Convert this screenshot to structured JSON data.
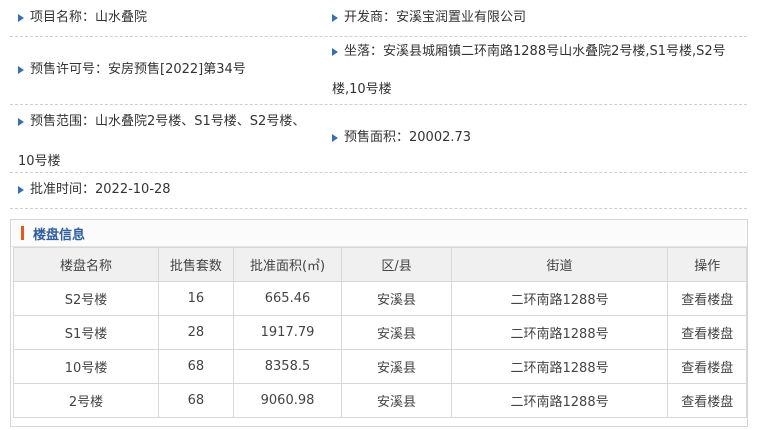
{
  "project": {
    "name_label": "项目名称：山水叠院",
    "developer_label": "开发商：安溪宝润置业有限公司",
    "permit_label": "预售许可号：安房预售[2022]第34号",
    "location_line1": "坐落：安溪县城厢镇二环南路1288号山水叠院2号楼,S1号楼,S2号",
    "location_line2": "楼,10号楼",
    "scope_line1": "预售范围：山水叠院2号楼、S1号楼、S2号楼、",
    "scope_line2": "10号楼",
    "area_label": "预售面积：20002.73",
    "approval_label": "批准时间：2022-10-28"
  },
  "section": {
    "title": "楼盘信息"
  },
  "table": {
    "headers": [
      "楼盘名称",
      "批售套数",
      "批准面积(㎡)",
      "区/县",
      "街道",
      "操作"
    ],
    "rows": [
      [
        "S2号楼",
        "16",
        "665.46",
        "安溪县",
        "二环南路1288号",
        "查看楼盘"
      ],
      [
        "S1号楼",
        "28",
        "1917.79",
        "安溪县",
        "二环南路1288号",
        "查看楼盘"
      ],
      [
        "10号楼",
        "68",
        "8358.5",
        "安溪县",
        "二环南路1288号",
        "查看楼盘"
      ],
      [
        "2号楼",
        "68",
        "9060.98",
        "安溪县",
        "二环南路1288号",
        "查看楼盘"
      ]
    ]
  }
}
